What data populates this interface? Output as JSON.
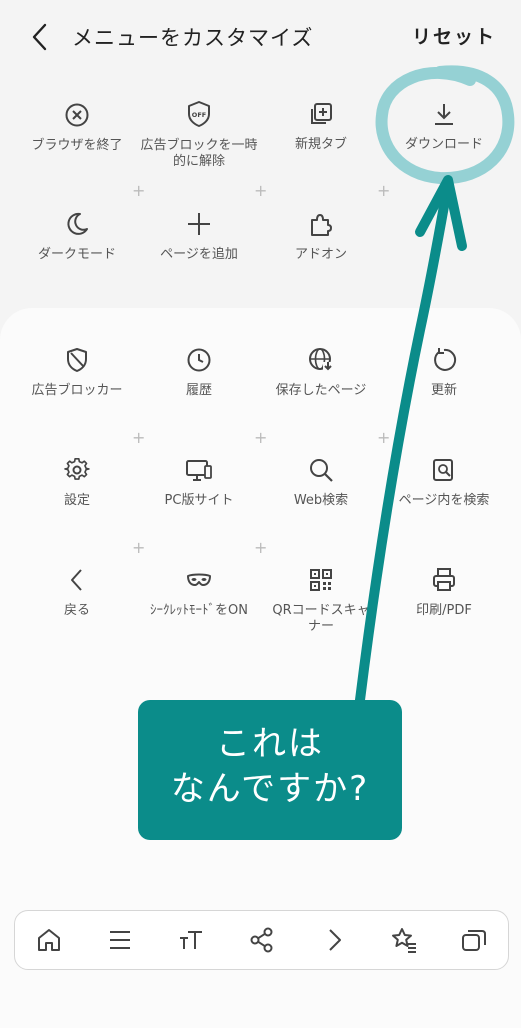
{
  "header": {
    "title": "メニューをカスタマイズ",
    "reset_label": "リセット"
  },
  "top_items": [
    {
      "label": "ブラウザを終了",
      "icon": "close-circle-icon"
    },
    {
      "label": "広告ブロックを一時\n的に解除",
      "icon": "ad-block-off-icon"
    },
    {
      "label": "新規タブ",
      "icon": "new-tab-icon"
    },
    {
      "label": "ダウンロード",
      "icon": "download-icon"
    },
    {
      "label": "ダークモード",
      "icon": "moon-icon"
    },
    {
      "label": "ページを追加",
      "icon": "plus-icon"
    },
    {
      "label": "アドオン",
      "icon": "puzzle-icon"
    }
  ],
  "card_items": [
    {
      "label": "広告ブロッカー",
      "icon": "shield-icon"
    },
    {
      "label": "履歴",
      "icon": "clock-icon"
    },
    {
      "label": "保存したページ",
      "icon": "globe-download-icon"
    },
    {
      "label": "更新",
      "icon": "refresh-icon"
    },
    {
      "label": "設定",
      "icon": "gear-icon"
    },
    {
      "label": "PC版サイト",
      "icon": "desktop-icon"
    },
    {
      "label": "Web検索",
      "icon": "search-icon"
    },
    {
      "label": "ページ内を検索",
      "icon": "find-in-page-icon"
    },
    {
      "label": "戻る",
      "icon": "chevron-left-icon"
    },
    {
      "label": "ｼｰｸﾚｯﾄﾓｰﾄﾞをON",
      "icon": "mask-icon"
    },
    {
      "label": "QRコードスキャ\nナー",
      "icon": "qr-code-icon"
    },
    {
      "label": "印刷/PDF",
      "icon": "printer-icon"
    }
  ],
  "bottom_bar": [
    {
      "icon": "home-icon"
    },
    {
      "icon": "menu-icon"
    },
    {
      "icon": "text-size-icon"
    },
    {
      "icon": "share-icon"
    },
    {
      "icon": "forward-icon"
    },
    {
      "icon": "bookmarks-icon"
    },
    {
      "icon": "tabs-icon"
    }
  ],
  "annotation": {
    "text": "これは\nなんですか?",
    "color": "#0b8c8a",
    "circle_color": "#8fcfd2"
  }
}
